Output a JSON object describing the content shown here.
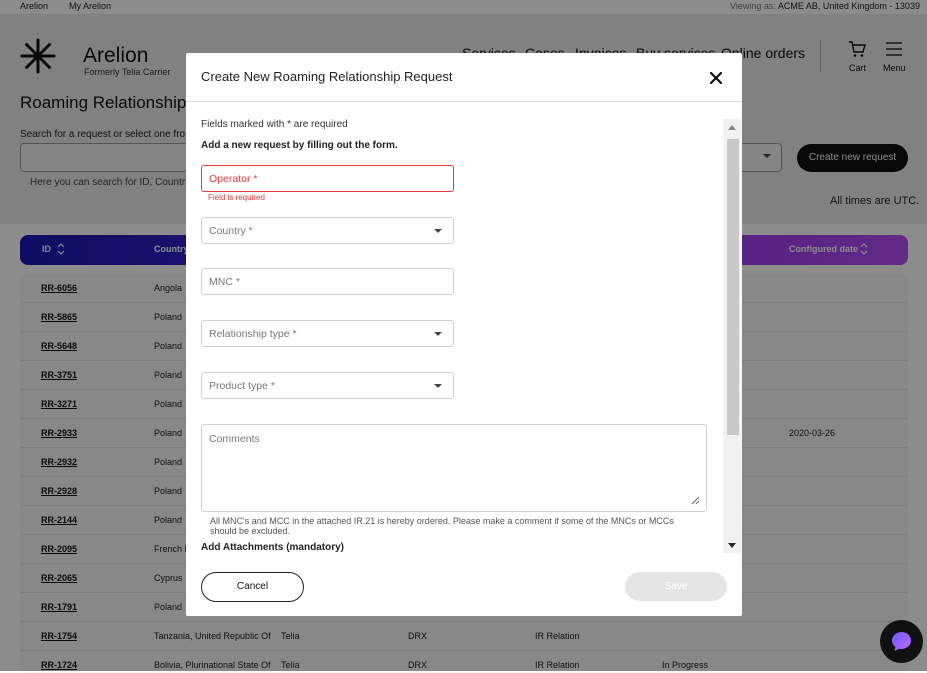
{
  "util": {
    "link1": "Arelion",
    "link2": "My Arelion",
    "viewing_prefix": "Viewing as: ",
    "viewing_value": "ACME AB, United Kingdom - 13039"
  },
  "header": {
    "brand": "Arelion",
    "brand_sub": "Formerly Telia Carrier",
    "nav": [
      "Services",
      "Cases",
      "Invoices",
      "Buy services",
      "Online orders"
    ],
    "cart_label": "Cart",
    "menu_label": "Menu"
  },
  "page": {
    "title": "Roaming Relationship",
    "search_label": "Search for a request or select one fro",
    "search_hint": "Here you can search for ID, Country, C",
    "create_button": "Create new request",
    "utc_note": "All times are UTC."
  },
  "table": {
    "headers": {
      "id": "ID",
      "country": "Country",
      "configured": "Configured date"
    },
    "rows": [
      {
        "id": "RR-6056",
        "country": "Angola"
      },
      {
        "id": "RR-5865",
        "country": "Poland"
      },
      {
        "id": "RR-5648",
        "country": "Poland"
      },
      {
        "id": "RR-3751",
        "country": "Poland"
      },
      {
        "id": "RR-3271",
        "country": "Poland"
      },
      {
        "id": "RR-2933",
        "country": "Poland",
        "configured": "2020-03-26"
      },
      {
        "id": "RR-2932",
        "country": "Poland"
      },
      {
        "id": "RR-2928",
        "country": "Poland"
      },
      {
        "id": "RR-2144",
        "country": "Poland"
      },
      {
        "id": "RR-2095",
        "country": "French P"
      },
      {
        "id": "RR-2065",
        "country": "Cyprus"
      },
      {
        "id": "RR-1791",
        "country": "Poland"
      },
      {
        "id": "RR-1754",
        "country": "Tanzania, United Republic Of",
        "op": "Telia",
        "type": "DRX",
        "product": "IR Relation"
      },
      {
        "id": "RR-1724",
        "country": "Bolivia, Plurinational State Of",
        "op": "Telia",
        "type": "DRX",
        "product": "IR Relation",
        "status": "In Progress"
      }
    ]
  },
  "modal": {
    "title": "Create New Roaming Relationship Request",
    "required_note": "Fields marked with * are required",
    "sub_note": "Add a new request by filling out the form.",
    "operator_placeholder": "Operator *",
    "operator_error": "Field is required",
    "country_placeholder": "Country *",
    "mnc_placeholder": "MNC *",
    "relationship_placeholder": "Relationship type *",
    "product_placeholder": "Product type *",
    "comments_placeholder": "Comments",
    "attach_note": "All MNC's and MCC in the attached IR.21 is hereby ordered. Please make a comment if some of the MNCs or MCCs should be excluded.",
    "attach_title": "Add Attachments (mandatory)",
    "cancel_label": "Cancel",
    "save_label": "Save"
  },
  "colors": {
    "accent_gradient_start": "#1919b8",
    "accent_gradient_end": "#b84cf5",
    "error": "#e53935",
    "primary_button": "#111111"
  },
  "icons": [
    "arelion-logo",
    "cart-icon",
    "menu-icon",
    "close-icon",
    "chevron-down-icon",
    "sort-icon",
    "chat-icon"
  ]
}
